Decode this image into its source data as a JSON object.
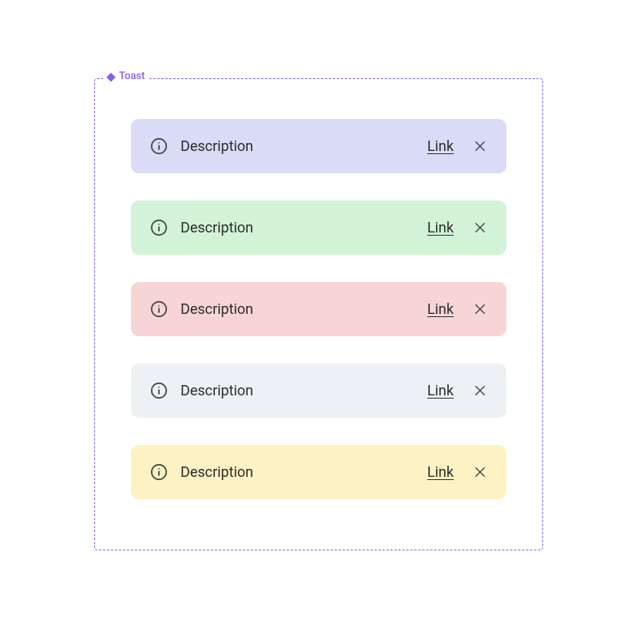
{
  "frame": {
    "label": "Toast"
  },
  "toasts": [
    {
      "description": "Description",
      "link_label": "Link",
      "bg": "#dadbf7"
    },
    {
      "description": "Description",
      "link_label": "Link",
      "bg": "#d3f3d8"
    },
    {
      "description": "Description",
      "link_label": "Link",
      "bg": "#f8d5d5"
    },
    {
      "description": "Description",
      "link_label": "Link",
      "bg": "#edf0f4"
    },
    {
      "description": "Description",
      "link_label": "Link",
      "bg": "#fcf2c3"
    }
  ]
}
